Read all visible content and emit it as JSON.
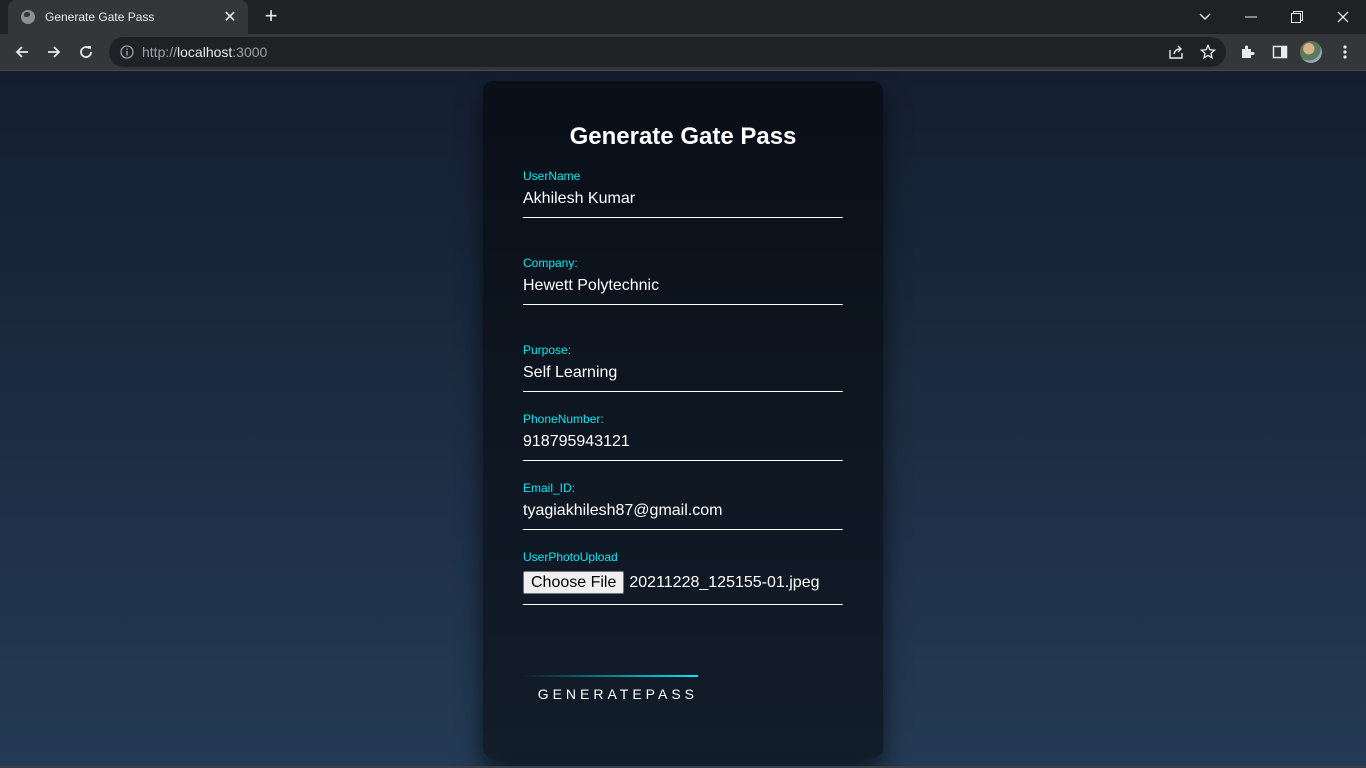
{
  "browser": {
    "tab_title": "Generate Gate Pass",
    "url_scheme": "http://",
    "url_host": "localhost",
    "url_port": ":3000"
  },
  "form": {
    "title": "Generate Gate Pass",
    "fields": [
      {
        "label": "UserName",
        "value": "Akhilesh Kumar"
      },
      {
        "label": "Company:",
        "value": "Hewett Polytechnic"
      },
      {
        "label": "Purpose:",
        "value": "Self Learning"
      },
      {
        "label": "PhoneNumber:",
        "value": "918795943121"
      },
      {
        "label": "Email_ID:",
        "value": "tyagiakhilesh87@gmail.com"
      }
    ],
    "photo": {
      "label": "UserPhotoUpload",
      "button_label": "Choose File",
      "file_name": "20211228_125155-01.jpeg"
    },
    "submit_label": "GENERATEPASS"
  },
  "colors": {
    "accent": "#03e9f4",
    "gradient_top": "#141e30",
    "gradient_bottom": "#243b55"
  }
}
